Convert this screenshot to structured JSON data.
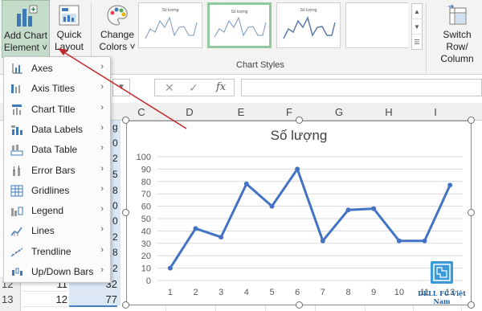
{
  "ribbon": {
    "add_chart_element": [
      "Add Chart",
      "Element ˅"
    ],
    "quick_layout": [
      "Quick",
      "Layout ˅"
    ],
    "change_colors": [
      "Change",
      "Colors ˅"
    ],
    "switch_row_column": [
      "Switch Row/",
      "Column"
    ],
    "chart_styles_label": "Chart Styles",
    "style_thumb_titles": [
      "Số lượng",
      "Số lượng",
      "Số lượng"
    ]
  },
  "formula_bar": {
    "fx_label": "fx"
  },
  "columns": [
    "C",
    "D",
    "E",
    "F",
    "G",
    "H",
    "I"
  ],
  "rows": [
    {
      "num": "12",
      "value": "32"
    },
    {
      "num": "13",
      "value": "77",
      "b": "12"
    }
  ],
  "partial_column_b": [
    "11",
    "12"
  ],
  "partial_values": [
    "g",
    "0",
    "2",
    "5",
    "8",
    "0",
    "0",
    "2",
    "8",
    "2",
    "2"
  ],
  "menu": {
    "items": [
      {
        "label": "Axes",
        "icon": "axes-icon"
      },
      {
        "label": "Axis Titles",
        "icon": "axis-titles-icon"
      },
      {
        "label": "Chart Title",
        "icon": "chart-title-icon"
      },
      {
        "label": "Data Labels",
        "icon": "data-labels-icon"
      },
      {
        "label": "Data Table",
        "icon": "data-table-icon"
      },
      {
        "label": "Error Bars",
        "icon": "error-bars-icon"
      },
      {
        "label": "Gridlines",
        "icon": "gridlines-icon"
      },
      {
        "label": "Legend",
        "icon": "legend-icon"
      },
      {
        "label": "Lines",
        "icon": "lines-icon"
      },
      {
        "label": "Trendline",
        "icon": "trendline-icon"
      },
      {
        "label": "Up/Down Bars",
        "icon": "up-down-bars-icon"
      }
    ]
  },
  "watermark": "DELL FC Việt Nam",
  "colors": {
    "accent_green": "#c5dccb",
    "line_blue": "#4472c4",
    "arrow_red": "#c0282d"
  },
  "chart_data": {
    "type": "line",
    "title": "Số lượng",
    "x": [
      1,
      2,
      3,
      4,
      5,
      6,
      7,
      8,
      9,
      10,
      11,
      12
    ],
    "values": [
      10,
      42,
      35,
      78,
      60,
      90,
      32,
      57,
      58,
      32,
      32,
      77
    ],
    "ylim": [
      0,
      100
    ],
    "yticks": [
      0,
      10,
      20,
      30,
      40,
      50,
      60,
      70,
      80,
      90,
      100
    ],
    "grid": true,
    "legend": "none"
  }
}
